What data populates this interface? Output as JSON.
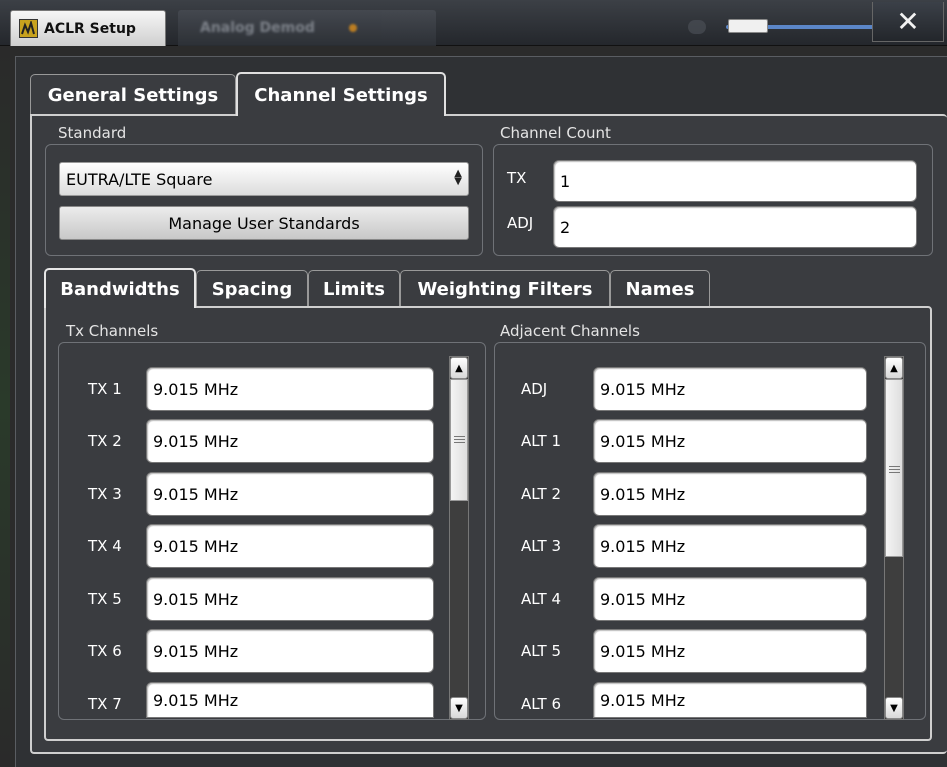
{
  "window": {
    "title": "ACLR Setup",
    "background_tab": "Analog Demod",
    "close_symbol": "✕"
  },
  "tabs": [
    {
      "label": "General Settings",
      "active": false
    },
    {
      "label": "Channel Settings",
      "active": true
    }
  ],
  "standard": {
    "group_label": "Standard",
    "selected": "EUTRA/LTE Square",
    "manage_button": "Manage User Standards"
  },
  "channel_count": {
    "group_label": "Channel Count",
    "tx_label": "TX",
    "tx_value": "1",
    "adj_label": "ADJ",
    "adj_value": "2"
  },
  "subtabs": [
    {
      "label": "Bandwidths",
      "active": true
    },
    {
      "label": "Spacing",
      "active": false
    },
    {
      "label": "Limits",
      "active": false
    },
    {
      "label": "Weighting Filters",
      "active": false
    },
    {
      "label": "Names",
      "active": false
    }
  ],
  "tx_channels": {
    "group_label": "Tx Channels",
    "rows": [
      {
        "label": "TX 1",
        "value": "9.015 MHz"
      },
      {
        "label": "TX 2",
        "value": "9.015 MHz"
      },
      {
        "label": "TX 3",
        "value": "9.015 MHz"
      },
      {
        "label": "TX 4",
        "value": "9.015 MHz"
      },
      {
        "label": "TX 5",
        "value": "9.015 MHz"
      },
      {
        "label": "TX 6",
        "value": "9.015 MHz"
      },
      {
        "label": "TX 7",
        "value": "9.015 MHz"
      }
    ]
  },
  "adjacent_channels": {
    "group_label": "Adjacent Channels",
    "rows": [
      {
        "label": "ADJ",
        "value": "9.015 MHz"
      },
      {
        "label": "ALT 1",
        "value": "9.015 MHz"
      },
      {
        "label": "ALT 2",
        "value": "9.015 MHz"
      },
      {
        "label": "ALT 3",
        "value": "9.015 MHz"
      },
      {
        "label": "ALT 4",
        "value": "9.015 MHz"
      },
      {
        "label": "ALT 5",
        "value": "9.015 MHz"
      },
      {
        "label": "ALT 6",
        "value": "9.015 MHz"
      }
    ]
  },
  "colors": {
    "accent": "#5b86c8",
    "panel": "#3a3c40",
    "logo": "#c8a21e"
  },
  "icons": {
    "close": "close-icon",
    "logo": "app-logo-icon",
    "scroll_up": "arrow-up-icon",
    "scroll_down": "arrow-down-icon"
  }
}
